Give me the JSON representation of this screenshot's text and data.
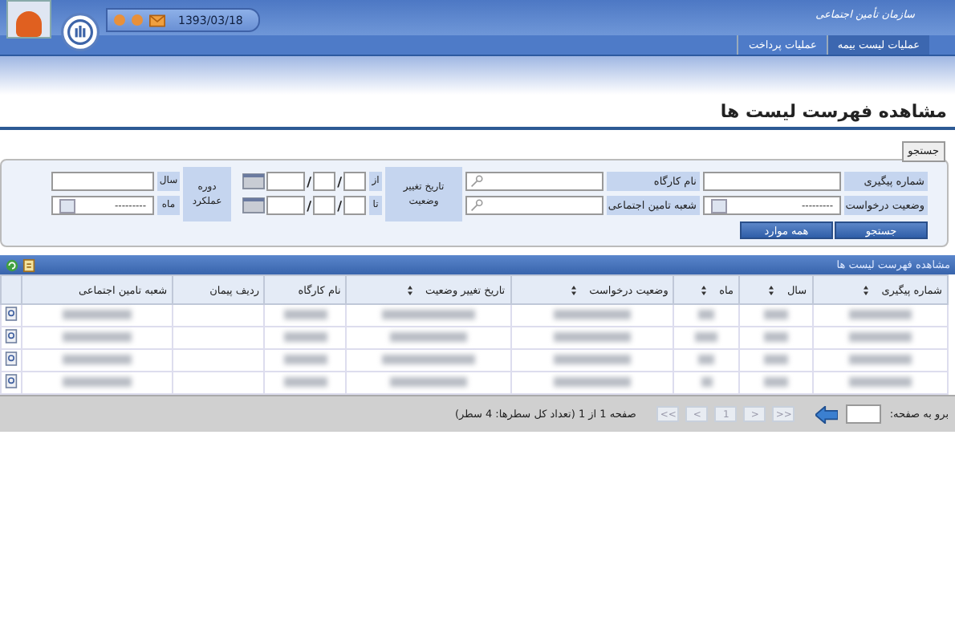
{
  "header": {
    "org_name": "سازمان تأمین اجتماعی",
    "date": "1393/03/18"
  },
  "menu": [
    {
      "label": "عملیات لیست بیمه",
      "selected": true
    },
    {
      "label": "عملیات پرداخت",
      "selected": false
    }
  ],
  "page_title": "مشاهده فهرست لیست ها",
  "search": {
    "legend": "جستجو",
    "tracking_label": "شماره پیگیری",
    "workshop_label": "نام کارگاه",
    "status_date_label": "تاریخ تغییر وضعیت",
    "from_label": "از",
    "date_separator": "/",
    "to_label": "تا",
    "period_label": "دوره عملکرد",
    "year_label": "سال",
    "request_status_label": "وضعیت درخواست",
    "request_status_value": "---------",
    "branch_label": "شعبه تامین اجتماعی",
    "month_label": "ماه",
    "month_value": "---------",
    "search_button": "جستجو",
    "all_button": "همه موارد"
  },
  "grid": {
    "title": "مشاهده فهرست لیست ها",
    "columns": [
      {
        "label": "شماره پیگیری",
        "sortable": true
      },
      {
        "label": "سال",
        "sortable": true
      },
      {
        "label": "ماه",
        "sortable": true
      },
      {
        "label": "وضعیت درخواست",
        "sortable": true
      },
      {
        "label": "تاریخ تغییر وضعیت",
        "sortable": true
      },
      {
        "label": "نام کارگاه",
        "sortable": false
      },
      {
        "label": "ردیف پیمان",
        "sortable": false
      },
      {
        "label": "شعبه تامین اجتماعی",
        "sortable": false
      }
    ],
    "rows": [
      {
        "kind": "blurred"
      },
      {
        "kind": "blurred"
      },
      {
        "kind": "blurred"
      },
      {
        "kind": "blurred"
      }
    ]
  },
  "pager": {
    "goto_label": "برو به صفحه:",
    "buttons": [
      ">>",
      ">",
      "1",
      "<",
      "<<"
    ],
    "summary": "صفحه 1 از 1 (تعداد کل سطرها: 4 سطر)"
  }
}
